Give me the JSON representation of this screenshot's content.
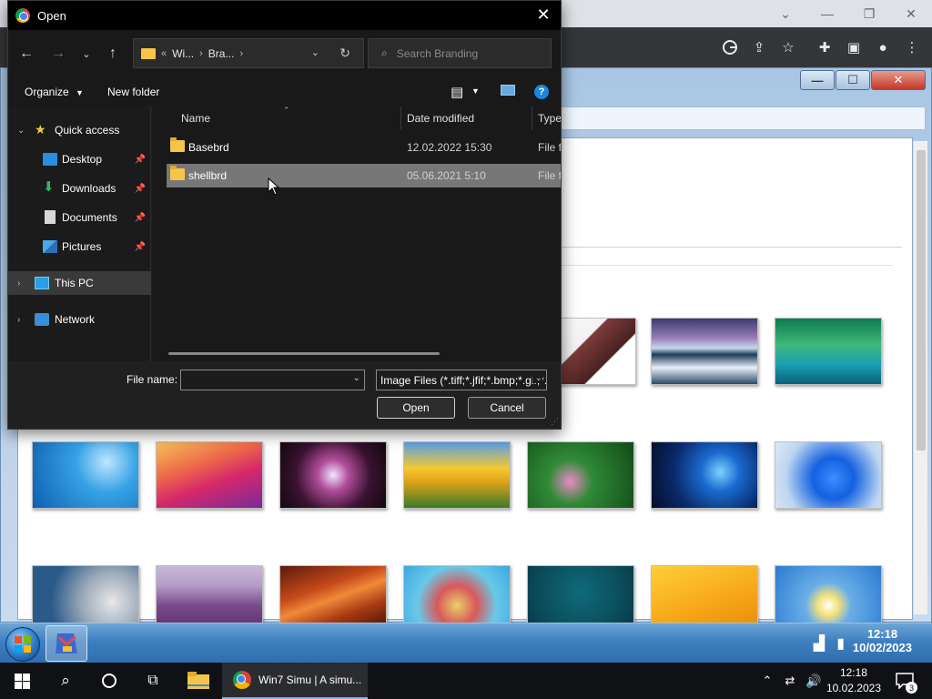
{
  "dialog": {
    "title": "Open",
    "breadcrumb": {
      "overflow": "«",
      "segments": [
        "Wi...",
        "Bra..."
      ]
    },
    "search_placeholder": "Search Branding",
    "commands": {
      "organize": "Organize",
      "new_folder": "New folder"
    },
    "nav_pane": {
      "quick_access": "Quick access",
      "items": [
        {
          "label": "Desktop",
          "icon": "desktop-icon"
        },
        {
          "label": "Downloads",
          "icon": "downloads-icon"
        },
        {
          "label": "Documents",
          "icon": "documents-icon"
        },
        {
          "label": "Pictures",
          "icon": "pictures-icon"
        }
      ],
      "this_pc": "This PC",
      "network": "Network"
    },
    "columns": [
      "Name",
      "Date modified",
      "Type"
    ],
    "files": [
      {
        "name": "Basebrd",
        "date": "12.02.2022 15:30",
        "type": "File folder"
      },
      {
        "name": "shellbrd",
        "date": "05.06.2021 5:10",
        "type": "File folder"
      }
    ],
    "file_name_label": "File name:",
    "file_name_value": "",
    "file_type_filter": "Image Files (*.tiff;*.jfif;*.bmp;*.gif;*.png;*.jpg;*.jpeg)",
    "open_button": "Open",
    "cancel_button": "Cancel"
  },
  "win7_tray": {
    "time": "12:18",
    "date": "10/02/2023"
  },
  "taskbar": {
    "active_app_label": "Win7 Simu | A simu...",
    "clock_time": "12:18",
    "clock_date": "10.02.2023",
    "notification_count": "3"
  },
  "colors": {
    "dialog_bg": "#202020",
    "selection": "#777777",
    "folder": "#f5c54a",
    "accent": "#0078d4"
  }
}
